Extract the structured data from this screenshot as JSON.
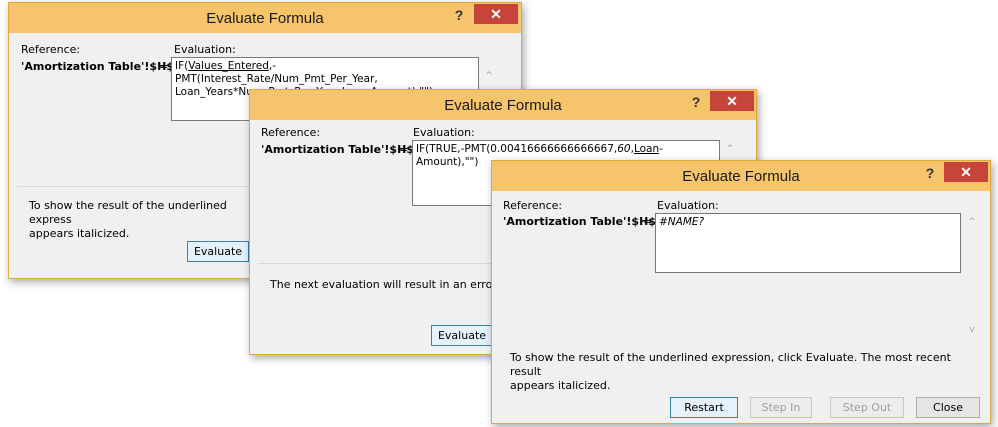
{
  "dialog1": {
    "title": "Evaluate Formula",
    "help": "?",
    "close": "✕",
    "reference_label": "Reference:",
    "reference_value": "'Amortization Table'!$H$6",
    "equals": "=",
    "evaluation_label": "Evaluation:",
    "formula_prefix": "IF(",
    "formula_underlined": "Values_Entered",
    "formula_line1_rest": ",-PMT(Interest_Rate/Num_Pmt_Per_Year,",
    "formula_line2": "Loan_Years*Num_Pmt_Per_Year,Loan-Amount),\"\")",
    "message": "To show the result of the underlined expression, click Evaluate. The most recent result appears italicized.",
    "message_line1": "To show the result of the underlined express",
    "message_line2": "appears italicized.",
    "evaluate_button": "Evaluate"
  },
  "dialog2": {
    "title": "Evaluate Formula",
    "help": "?",
    "close": "✕",
    "reference_label": "Reference:",
    "reference_value": "'Amortization Table'!$H$6",
    "equals": "=",
    "evaluation_label": "Evaluation:",
    "formula_prefix": "IF(TRUE,-PMT(0.00416666666666667,",
    "formula_italic": "60",
    "formula_comma": ",",
    "formula_underlined": "Loan",
    "formula_rest": "-Amount),\"\")",
    "message": "The next evaluation will result in an error.",
    "evaluate_button": "Evaluate"
  },
  "dialog3": {
    "title": "Evaluate Formula",
    "help": "?",
    "close": "✕",
    "reference_label": "Reference:",
    "reference_value": "'Amortization Table'!$H$6",
    "equals": "=",
    "evaluation_label": "Evaluation:",
    "formula_result": "#NAME?",
    "message_line1": "To show the result of the underlined expression, click Evaluate.  The most recent result",
    "message_line2": "appears italicized.",
    "restart_button": "Restart",
    "step_in_button": "Step In",
    "step_out_button": "Step Out",
    "close_button": "Close"
  },
  "colors": {
    "title_bar": "#f6c46a",
    "close_button": "#c7443a",
    "dialog_bg": "#f0f0f0"
  }
}
